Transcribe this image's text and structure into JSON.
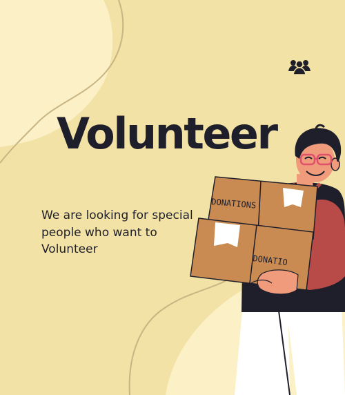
{
  "headline": "Volunteer",
  "tagline": "We are looking for special people who want to Volunteer",
  "box_labels": {
    "top": "DONATIONS",
    "bottom": "DONATIO"
  },
  "colors": {
    "background": "#f2e2a5",
    "blob": "#fbf0c6",
    "text": "#1f1f2b",
    "box": "#c98b52",
    "shirt": "#1f1f2b",
    "sleeve": "#b84a48",
    "skin": "#ef9b7c"
  },
  "icons": {
    "top_right": "group-of-people-icon"
  }
}
